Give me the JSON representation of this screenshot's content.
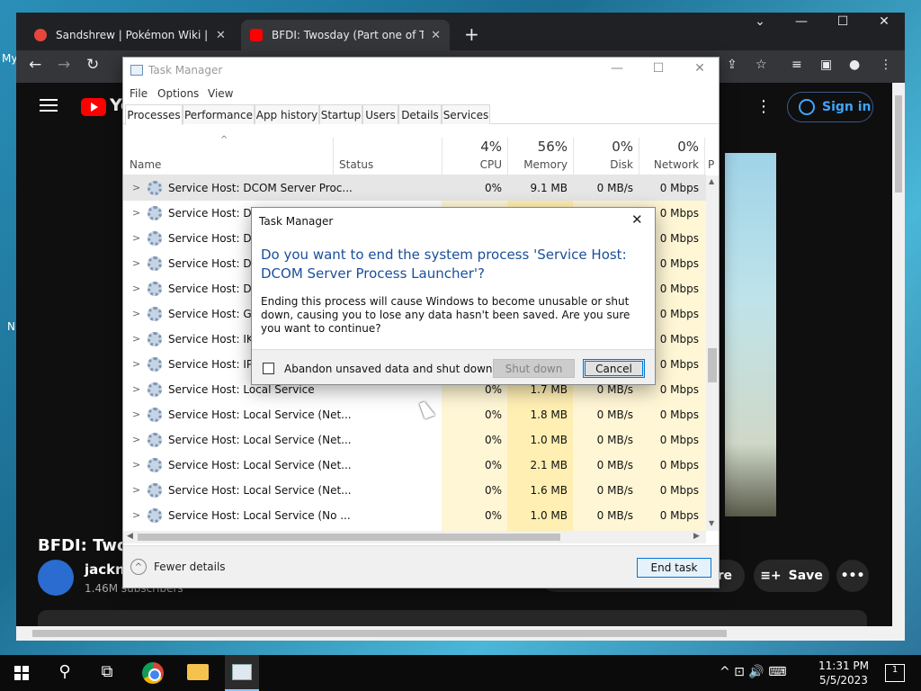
{
  "desktop": {
    "label_my": "My",
    "label_n": "N"
  },
  "browser": {
    "tabs": [
      {
        "title": "Sandshrew | Pokémon Wiki | Fandom",
        "close": "✕",
        "icon_color": "#e8453c"
      },
      {
        "title": "BFDI: Twosday (Part one of TWO)",
        "close": "✕",
        "icon_color": "#ff0000"
      }
    ],
    "new_tab": "+",
    "window_controls": {
      "collapse": "⌄",
      "minimize": "—",
      "maximize": "☐",
      "close": "✕"
    },
    "nav": {
      "back": "←",
      "forward": "→",
      "reload": "↻"
    },
    "toolbar_icons": {
      "share": "⇪",
      "star": "☆",
      "media": "≡",
      "sidepanel": "▣",
      "profile": "●",
      "menu": "⋮"
    }
  },
  "youtube": {
    "logo_text": "Yo",
    "sign_in": "Sign in",
    "more": "⋮",
    "video_title": "BFDI: Twos",
    "channel_name": "jacknj",
    "subscribers": "1.46M subscribers",
    "share_label": "re",
    "save_label": "Save",
    "more_actions": "•••"
  },
  "task_manager": {
    "title": "Task Manager",
    "window_controls": {
      "minimize": "—",
      "maximize": "☐",
      "close": "✕"
    },
    "menu": [
      "File",
      "Options",
      "View"
    ],
    "tabs": [
      "Processes",
      "Performance",
      "App history",
      "Startup",
      "Users",
      "Details",
      "Services"
    ],
    "columns": {
      "name": "Name",
      "status": "Status",
      "cpu": {
        "pct": "4%",
        "label": "CPU"
      },
      "memory": {
        "pct": "56%",
        "label": "Memory"
      },
      "disk": {
        "pct": "0%",
        "label": "Disk"
      },
      "network": {
        "pct": "0%",
        "label": "Network"
      },
      "power": "P"
    },
    "sort_arrow": "^",
    "rows": [
      {
        "name": "Service Host: DCOM Server Proc...",
        "cpu": "0%",
        "memory": "9.1 MB",
        "disk": "0 MB/s",
        "network": "0 Mbps"
      },
      {
        "name": "Service Host: DHC",
        "cpu": "",
        "memory": "",
        "disk": "",
        "network": "0 Mbps"
      },
      {
        "name": "Service Host: Disp",
        "cpu": "",
        "memory": "",
        "disk": "",
        "network": "0 Mbps"
      },
      {
        "name": "Service Host: Dist",
        "cpu": "",
        "memory": "",
        "disk": "",
        "network": "0 Mbps"
      },
      {
        "name": "Service Host: DNS",
        "cpu": "",
        "memory": "",
        "disk": "",
        "network": "0 Mbps"
      },
      {
        "name": "Service Host: Grou",
        "cpu": "",
        "memory": "",
        "disk": "",
        "network": "0 Mbps"
      },
      {
        "name": "Service Host: IKE",
        "cpu": "",
        "memory": "",
        "disk": "",
        "network": "0 Mbps"
      },
      {
        "name": "Service Host: IP H",
        "cpu": "",
        "memory": "",
        "disk": "",
        "network": "0 Mbps"
      },
      {
        "name": "Service Host: Local Service",
        "cpu": "0%",
        "memory": "1.7 MB",
        "disk": "0 MB/s",
        "network": "0 Mbps"
      },
      {
        "name": "Service Host: Local Service (Net...",
        "cpu": "0%",
        "memory": "1.8 MB",
        "disk": "0 MB/s",
        "network": "0 Mbps"
      },
      {
        "name": "Service Host: Local Service (Net...",
        "cpu": "0%",
        "memory": "1.0 MB",
        "disk": "0 MB/s",
        "network": "0 Mbps"
      },
      {
        "name": "Service Host: Local Service (Net...",
        "cpu": "0%",
        "memory": "2.1 MB",
        "disk": "0 MB/s",
        "network": "0 Mbps"
      },
      {
        "name": "Service Host: Local Service (Net...",
        "cpu": "0%",
        "memory": "1.6 MB",
        "disk": "0 MB/s",
        "network": "0 Mbps"
      },
      {
        "name": "Service Host: Local Service (No ...",
        "cpu": "0%",
        "memory": "1.0 MB",
        "disk": "0 MB/s",
        "network": "0 Mbps"
      }
    ],
    "fewer_details": "Fewer details",
    "end_task": "End task"
  },
  "dialog": {
    "title": "Task Manager",
    "close": "✕",
    "question": "Do you want to end the system process 'Service Host: DCOM Server Process Launcher'?",
    "message": "Ending this process will cause Windows to become unusable or shut down, causing you to lose any data hasn't been saved. Are you sure you want to continue?",
    "checkbox_label": "Abandon unsaved data and shut down.",
    "shutdown_button": "Shut down",
    "cancel_button": "Cancel"
  },
  "taskbar": {
    "search": "⚲",
    "task_view": "⧉",
    "tray": "^ ⊡ 🔊 ⌨",
    "time": "11:31 PM",
    "date": "5/5/2023",
    "notifications": "1"
  }
}
